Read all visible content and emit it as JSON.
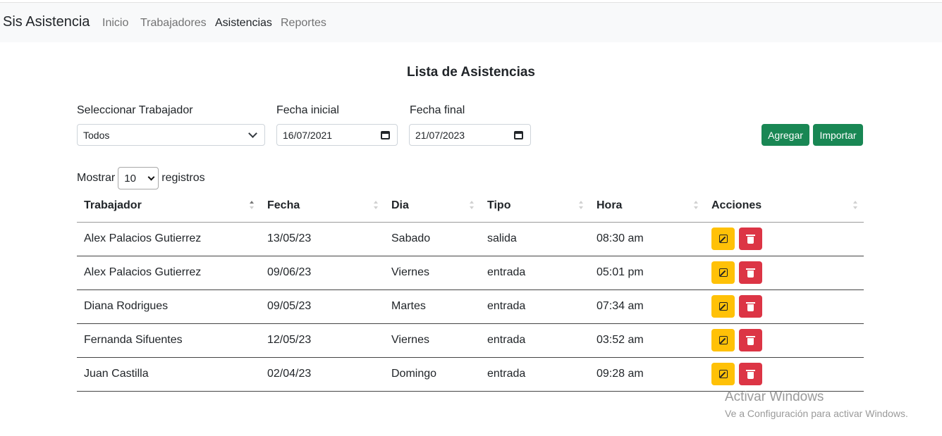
{
  "navbar": {
    "brand": "Sis Asistencia",
    "links": [
      {
        "label": "Inicio",
        "active": false
      },
      {
        "label": "Trabajadores",
        "active": false
      },
      {
        "label": "Asistencias",
        "active": true
      },
      {
        "label": "Reportes",
        "active": false
      }
    ]
  },
  "page": {
    "title": "Lista de Asistencias"
  },
  "filters": {
    "worker": {
      "label": "Seleccionar Trabajador",
      "value": "Todos"
    },
    "start_date": {
      "label": "Fecha inicial",
      "value": "16/07/2021"
    },
    "end_date": {
      "label": "Fecha final",
      "value": "21/07/2023"
    }
  },
  "actions": {
    "add_label": "Agregar",
    "import_label": "Importar"
  },
  "length_menu": {
    "prefix": "Mostrar",
    "value": "10",
    "suffix": "registros"
  },
  "table": {
    "headers": [
      "Trabajador",
      "Fecha",
      "Dia",
      "Tipo",
      "Hora",
      "Acciones"
    ],
    "rows": [
      [
        "Alex Palacios Gutierrez",
        "13/05/23",
        "Sabado",
        "salida",
        "08:30 am"
      ],
      [
        "Alex Palacios Gutierrez",
        "09/06/23",
        "Viernes",
        "entrada",
        "05:01 pm"
      ],
      [
        "Diana Rodrigues",
        "09/05/23",
        "Martes",
        "entrada",
        "07:34 am"
      ],
      [
        "Fernanda Sifuentes",
        "12/05/23",
        "Viernes",
        "entrada",
        "03:52 am"
      ],
      [
        "Juan Castilla",
        "02/04/23",
        "Domingo",
        "entrada",
        "09:28 am"
      ]
    ]
  },
  "watermark": {
    "title": "Activar Windows",
    "subtitle": "Ve a Configuración para activar Windows."
  },
  "colors": {
    "primary_green": "#198754",
    "edit_yellow": "#ffc107",
    "delete_red": "#dc3545",
    "navbar_bg": "#f8f9fa"
  }
}
